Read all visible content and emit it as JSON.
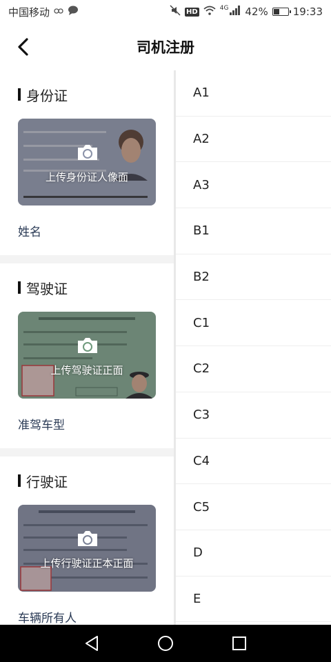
{
  "status_bar": {
    "carrier": "中国移动",
    "hd": "HD",
    "network": "4G",
    "battery": "42%",
    "battery_level": 0.42,
    "time": "19:33"
  },
  "header": {
    "title": "司机注册"
  },
  "sections": [
    {
      "title": "身份证",
      "caption": "上传身份证人像面",
      "field": "姓名",
      "card_color": "#8a92a8"
    },
    {
      "title": "驾驶证",
      "caption": "上传驾驶证正面",
      "field": "准驾车型",
      "card_color": "#6f9a7c"
    },
    {
      "title": "行驶证",
      "caption": "上传行驶证正本正面",
      "field": "车辆所有人",
      "card_color": "#7b8296"
    }
  ],
  "license_classes": [
    "A1",
    "A2",
    "A3",
    "B1",
    "B2",
    "C1",
    "C2",
    "C3",
    "C4",
    "C5",
    "D",
    "E"
  ],
  "colors": {
    "accent": "#111111",
    "nav_bg": "#000000"
  }
}
